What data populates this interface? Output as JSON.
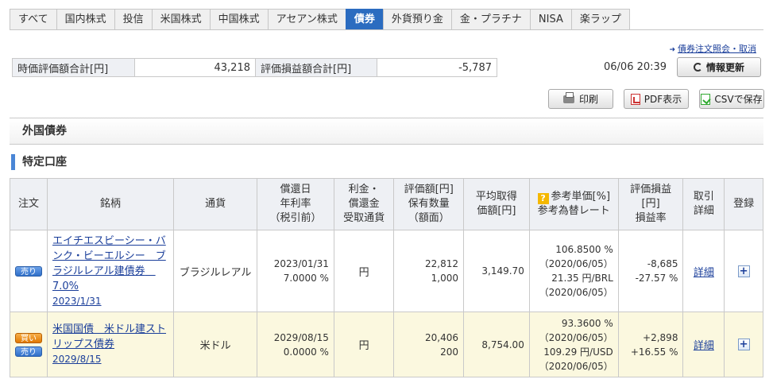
{
  "tabs": [
    {
      "label": "すべて",
      "active": false
    },
    {
      "label": "国内株式",
      "active": false
    },
    {
      "label": "投信",
      "active": false
    },
    {
      "label": "米国株式",
      "active": false
    },
    {
      "label": "中国株式",
      "active": false
    },
    {
      "label": "アセアン株式",
      "active": false
    },
    {
      "label": "債券",
      "active": true
    },
    {
      "label": "外貨預り金",
      "active": false
    },
    {
      "label": "金・プラチナ",
      "active": false
    },
    {
      "label": "NISA",
      "active": false
    },
    {
      "label": "楽ラップ",
      "active": false
    }
  ],
  "order_link": "債券注文照会・取消",
  "summary": {
    "market_value_label": "時価評価額合計[円]",
    "market_value": "43,218",
    "pl_label": "評価損益額合計[円]",
    "pl": "-5,787"
  },
  "timestamp": "06/06 20:39",
  "buttons": {
    "refresh": "情報更新",
    "print": "印刷",
    "pdf": "PDF表示",
    "csv": "CSVで保存"
  },
  "section_title": "外国債券",
  "account_title": "特定口座",
  "table": {
    "headers": {
      "order": "注文",
      "name": "銘柄",
      "currency": "通貨",
      "maturity": [
        "償還日",
        "年利率",
        "（税引前）"
      ],
      "interest": [
        "利金・",
        "償還金",
        "受取通貨"
      ],
      "valuation": [
        "評価額[円]",
        "保有数量",
        "（額面）"
      ],
      "avg_cost": [
        "平均取得",
        "価額[円]"
      ],
      "ref_price": [
        "参考単価[%]",
        "参考為替レート"
      ],
      "pl": [
        "評価損益",
        "[円]",
        "損益率"
      ],
      "history": [
        "取引",
        "詳細"
      ],
      "register": "登録"
    },
    "rows": [
      {
        "buttons": [
          "売り"
        ],
        "name": "エイチエスビーシー・バンク・ビーエルシー　ブラジルレアル建債券　7.0%",
        "maturity_link": "2023/1/31",
        "currency": "ブラジルレアル",
        "maturity_date": "2023/01/31",
        "rate": "7.0000 %",
        "interest_currency": "円",
        "valuation": "22,812",
        "quantity": "1,000",
        "avg_cost": "3,149.70",
        "ref_price": "106.8500 %",
        "ref_price_date": "（2020/06/05）",
        "fx_rate": "21.35 円/BRL",
        "fx_date": "（2020/06/05）",
        "pl_amount": "-8,685",
        "pl_rate": "-27.57 %",
        "detail": "詳細"
      },
      {
        "buttons": [
          "買い",
          "売り"
        ],
        "name": "米国国債　米ドル建ストリップス債券",
        "maturity_link": "2029/8/15",
        "currency": "米ドル",
        "maturity_date": "2029/08/15",
        "rate": "0.0000 %",
        "interest_currency": "円",
        "valuation": "20,406",
        "quantity": "200",
        "avg_cost": "8,754.00",
        "ref_price": "93.3600 %",
        "ref_price_date": "（2020/06/05）",
        "fx_rate": "109.29 円/USD",
        "fx_date": "（2020/06/05）",
        "pl_amount": "+2,898",
        "pl_rate": "+16.55 %",
        "detail": "詳細"
      }
    ]
  },
  "colors": {
    "accent": "#2b6cc0",
    "positive": "#dd0000",
    "negative": "#1a8a1a"
  }
}
